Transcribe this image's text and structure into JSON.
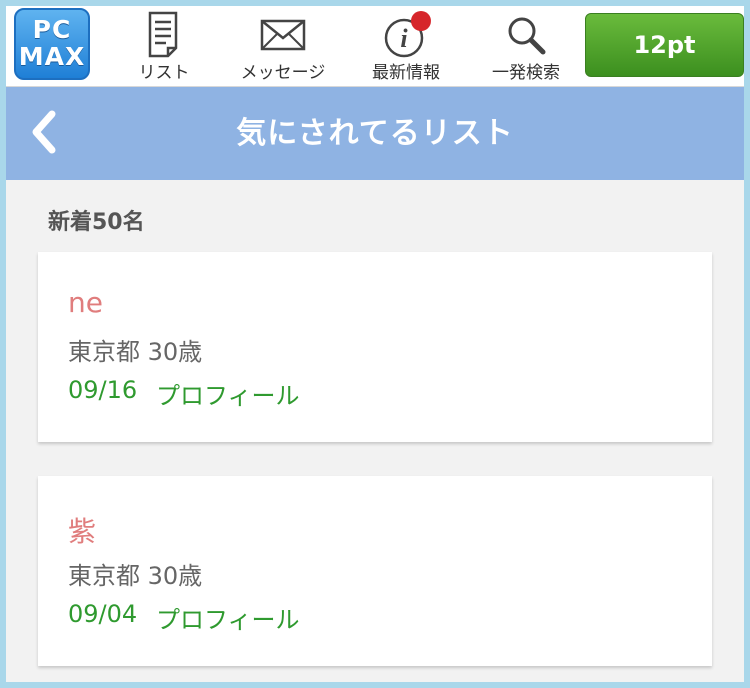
{
  "header": {
    "logo_line1": "PC",
    "logo_line2": "MAX",
    "nav": [
      {
        "label": "リスト",
        "icon": "list-document-icon"
      },
      {
        "label": "メッセージ",
        "icon": "envelope-icon"
      },
      {
        "label": "最新情報",
        "icon": "info-icon",
        "badge": "!"
      },
      {
        "label": "一発検索",
        "icon": "search-icon"
      }
    ],
    "points": "12pt"
  },
  "page": {
    "title": "気にされてるリスト",
    "section": "新着50名"
  },
  "cards": [
    {
      "name": "ne",
      "location": "東京都 30歳",
      "date": "09/16",
      "profile_link": "プロフィール"
    },
    {
      "name": "紫",
      "location": "東京都 30歳",
      "date": "09/04",
      "profile_link": "プロフィール"
    }
  ],
  "colors": {
    "accent_blue": "#8fb3e3",
    "green": "#4ea52b",
    "name_pink": "#e07d7d",
    "link_green": "#2f9a2f",
    "frame": "#a9d7ea"
  }
}
